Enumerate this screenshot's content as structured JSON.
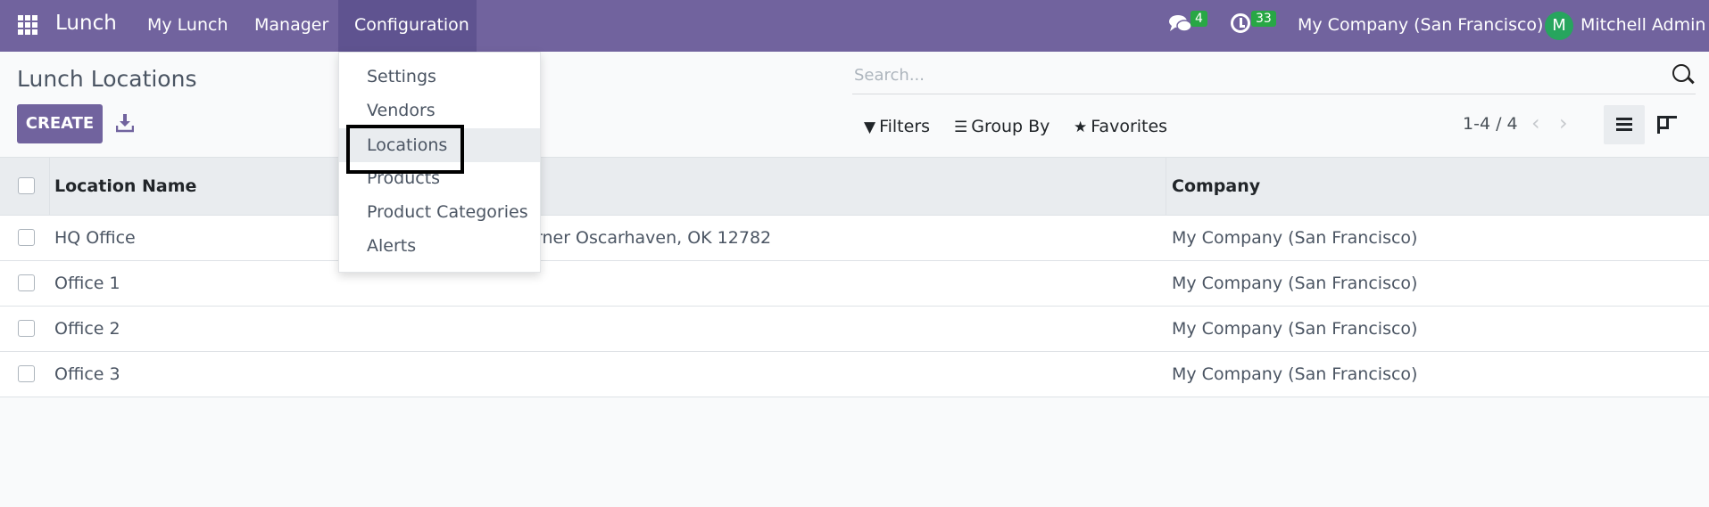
{
  "navbar": {
    "app_name": "Lunch",
    "menu": [
      "My Lunch",
      "Manager",
      "Configuration"
    ],
    "messages_count": "4",
    "activities_count": "33",
    "company": "My Company (San Francisco)",
    "user_initial": "M",
    "user_name": "Mitchell Admin",
    "bar_color": "#71639e"
  },
  "control_panel": {
    "title": "Lunch Locations",
    "create_label": "CREATE",
    "search_placeholder": "Search...",
    "filters_label": "Filters",
    "group_by_label": "Group By",
    "favorites_label": "Favorites",
    "pager": "1-4 / 4"
  },
  "dropdown": {
    "items": [
      "Settings",
      "Vendors",
      "Locations",
      "Products",
      "Product Categories",
      "Alerts"
    ],
    "active_item": "Locations"
  },
  "table": {
    "columns": [
      "Location Name",
      "Company"
    ],
    "rows": [
      {
        "name": "HQ Office",
        "address": "rner Oscarhaven, OK 12782",
        "company": "My Company (San Francisco)"
      },
      {
        "name": "Office 1",
        "address": "",
        "company": "My Company (San Francisco)"
      },
      {
        "name": "Office 2",
        "address": "",
        "company": "My Company (San Francisco)"
      },
      {
        "name": "Office 3",
        "address": "",
        "company": "My Company (San Francisco)"
      }
    ]
  }
}
